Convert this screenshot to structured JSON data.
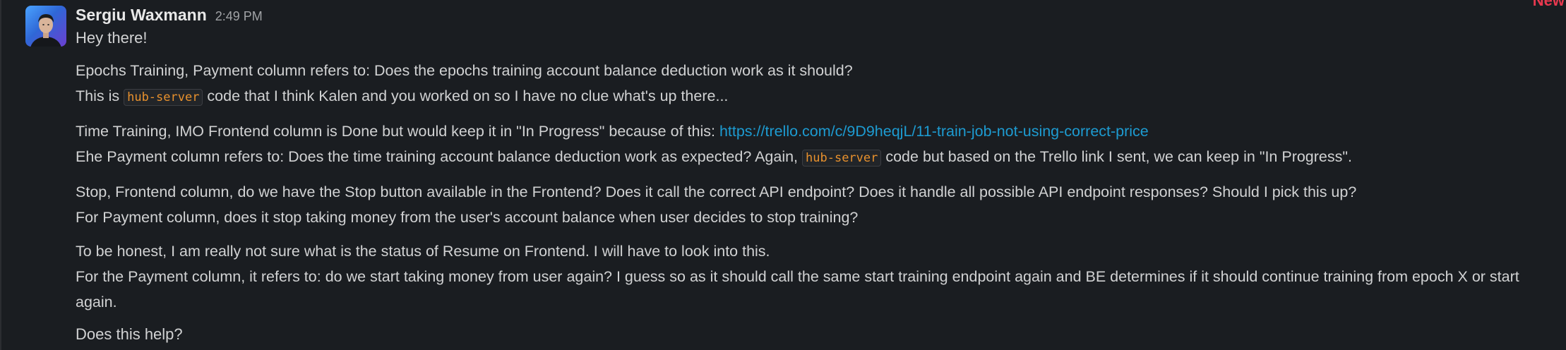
{
  "badge": {
    "new_label": "New"
  },
  "message": {
    "sender": "Sergiu Waxmann",
    "time": "2:49 PM",
    "greeting": "Hey there!",
    "p1": {
      "l1": "Epochs Training, Payment column refers to: Does the epochs training account balance deduction work as it should?",
      "l2_pre": "This is ",
      "l2_code": "hub-server",
      "l2_post": " code that I think Kalen and you worked on so I have no clue what's up there..."
    },
    "p2": {
      "l1_pre": "Time Training, IMO Frontend column is Done but would keep it in \"In Progress\" because of this: ",
      "l1_link": "https://trello.com/c/9D9heqjL/11-train-job-not-using-correct-price",
      "l2_pre": "Ehe Payment column refers to: Does the time training account balance deduction work as expected? Again, ",
      "l2_code": "hub-server",
      "l2_post": " code but based on the Trello link I sent, we can keep in \"In Progress\"."
    },
    "p3": {
      "l1": "Stop, Frontend column, do we have the Stop button available in the Frontend? Does it call the correct API endpoint? Does it handle all possible API endpoint responses? Should I pick this up?",
      "l2": "For Payment column, does it stop taking money from the user's account balance when user decides to stop training?"
    },
    "p4": {
      "l1": "To be honest, I am really not sure what is the status of Resume on Frontend. I will have to look into this.",
      "l2": "For the Payment column, it refers to: do we start taking money from user again? I guess so as it should call the same start training endpoint again and BE determines if it should continue training from epoch X or start again."
    },
    "closing": "Does this help?"
  }
}
